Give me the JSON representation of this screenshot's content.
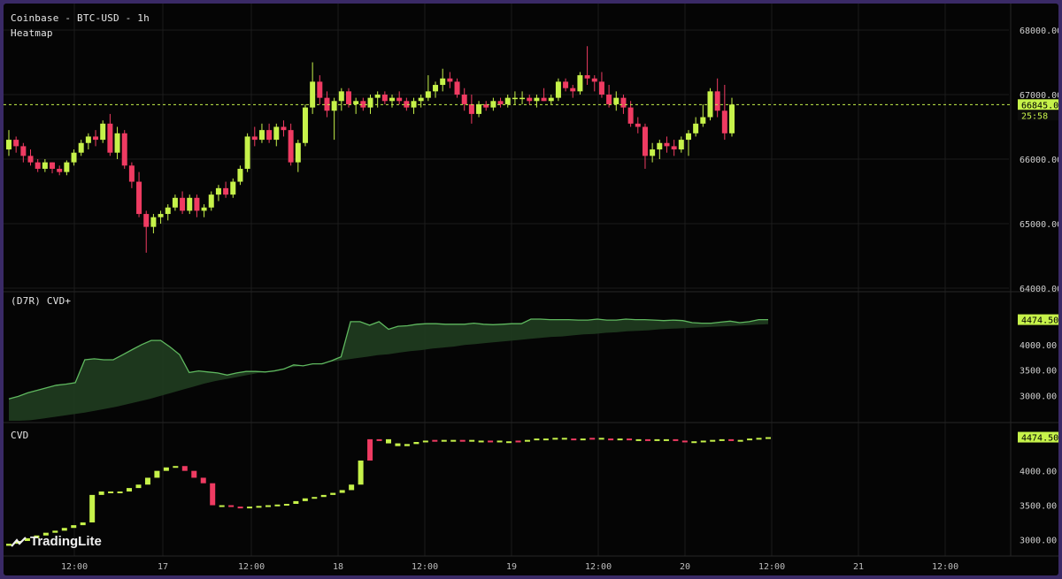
{
  "header": {
    "title": "Coinbase - BTC-USD - 1h",
    "overlay": "Heatmap"
  },
  "panes": {
    "cvd_plus_title": "(D7R) CVD+",
    "cvd_title": "CVD"
  },
  "brand": {
    "name": "TradingLite"
  },
  "colors": {
    "up": "#c6f24a",
    "down": "#ef3b62",
    "grid": "#1c1c1c",
    "axis_text": "#d0d0d0",
    "last_price_line": "#c6f24a",
    "cvd_fill": "#1f3a1f",
    "cvd_line": "#5fb85f",
    "background": "#050505"
  },
  "chart_data": [
    {
      "type": "candlestick",
      "title": "Coinbase - BTC-USD - 1h",
      "ylim": [
        64000,
        68000
      ],
      "y_ticks": [
        "68000.00",
        "67000.00",
        "66000.00",
        "65000.00",
        "64000.00"
      ],
      "last_price_label": "66845.02",
      "countdown_label": "25:58",
      "last_price": 66845.02,
      "x_ticks": [
        "12:00",
        "17",
        "12:00",
        "18",
        "12:00",
        "19",
        "12:00",
        "20",
        "12:00",
        "21",
        "12:00"
      ],
      "candles": [
        [
          66150,
          66450,
          66050,
          66300
        ],
        [
          66300,
          66350,
          66100,
          66200
        ],
        [
          66200,
          66250,
          65950,
          66050
        ],
        [
          66050,
          66150,
          65900,
          65950
        ],
        [
          65950,
          66000,
          65800,
          65850
        ],
        [
          65850,
          66000,
          65800,
          65950
        ],
        [
          65950,
          65950,
          65780,
          65850
        ],
        [
          65850,
          65900,
          65750,
          65800
        ],
        [
          65800,
          65980,
          65750,
          65950
        ],
        [
          65950,
          66150,
          65900,
          66100
        ],
        [
          66100,
          66300,
          66050,
          66250
        ],
        [
          66250,
          66400,
          66150,
          66350
        ],
        [
          66350,
          66450,
          66200,
          66300
        ],
        [
          66300,
          66600,
          66250,
          66550
        ],
        [
          66550,
          66700,
          66050,
          66100
        ],
        [
          66100,
          66500,
          66000,
          66400
        ],
        [
          66400,
          66450,
          65850,
          65900
        ],
        [
          65900,
          65950,
          65550,
          65650
        ],
        [
          65650,
          65800,
          65100,
          65150
        ],
        [
          65150,
          65200,
          64550,
          64950
        ],
        [
          64950,
          65150,
          64850,
          65100
        ],
        [
          65100,
          65200,
          65000,
          65150
        ],
        [
          65150,
          65300,
          65050,
          65250
        ],
        [
          65250,
          65450,
          65200,
          65400
        ],
        [
          65400,
          65500,
          65150,
          65200
        ],
        [
          65200,
          65450,
          65150,
          65400
        ],
        [
          65400,
          65450,
          65100,
          65200
        ],
        [
          65200,
          65300,
          65100,
          65250
        ],
        [
          65250,
          65500,
          65200,
          65450
        ],
        [
          65450,
          65600,
          65350,
          65550
        ],
        [
          65550,
          65650,
          65400,
          65450
        ],
        [
          65450,
          65700,
          65400,
          65650
        ],
        [
          65650,
          65900,
          65600,
          65850
        ],
        [
          65850,
          66400,
          65800,
          66350
        ],
        [
          66350,
          66500,
          66200,
          66300
        ],
        [
          66300,
          66550,
          66250,
          66450
        ],
        [
          66450,
          66550,
          66250,
          66300
        ],
        [
          66300,
          66550,
          66200,
          66500
        ],
        [
          66500,
          66600,
          66350,
          66450
        ],
        [
          66450,
          66550,
          65900,
          65950
        ],
        [
          65950,
          66300,
          65800,
          66250
        ],
        [
          66250,
          66850,
          66200,
          66800
        ],
        [
          66800,
          67500,
          66700,
          67200
        ],
        [
          67200,
          67300,
          66850,
          66950
        ],
        [
          66950,
          67050,
          66650,
          66750
        ],
        [
          66750,
          66950,
          66300,
          66900
        ],
        [
          66900,
          67100,
          66750,
          67050
        ],
        [
          67050,
          67100,
          66800,
          66850
        ],
        [
          66850,
          66950,
          66700,
          66900
        ],
        [
          66900,
          66950,
          66750,
          66800
        ],
        [
          66800,
          67000,
          66700,
          66950
        ],
        [
          66950,
          67050,
          66800,
          67000
        ],
        [
          67000,
          67050,
          66850,
          66900
        ],
        [
          66900,
          67000,
          66800,
          66950
        ],
        [
          66950,
          67050,
          66850,
          66900
        ],
        [
          66900,
          66950,
          66750,
          66800
        ],
        [
          66800,
          66950,
          66700,
          66900
        ],
        [
          66900,
          67000,
          66800,
          66950
        ],
        [
          66950,
          67300,
          66900,
          67050
        ],
        [
          67050,
          67200,
          66950,
          67150
        ],
        [
          67150,
          67400,
          67050,
          67250
        ],
        [
          67250,
          67350,
          67100,
          67200
        ],
        [
          67200,
          67250,
          66950,
          67000
        ],
        [
          67000,
          67100,
          66750,
          66850
        ],
        [
          66850,
          67000,
          66550,
          66700
        ],
        [
          66700,
          66900,
          66650,
          66850
        ],
        [
          66850,
          66900,
          66750,
          66800
        ],
        [
          66800,
          66950,
          66750,
          66900
        ],
        [
          66900,
          66950,
          66800,
          66850
        ],
        [
          66850,
          67000,
          66800,
          66950
        ],
        [
          66950,
          67050,
          66850,
          66950
        ],
        [
          66950,
          67050,
          66850,
          66950
        ],
        [
          66950,
          67000,
          66850,
          66900
        ],
        [
          66900,
          67000,
          66800,
          66950
        ],
        [
          66950,
          67100,
          66900,
          66900
        ],
        [
          66900,
          67000,
          66850,
          66950
        ],
        [
          66950,
          67250,
          66900,
          67200
        ],
        [
          67200,
          67250,
          67050,
          67100
        ],
        [
          67100,
          67150,
          66950,
          67050
        ],
        [
          67050,
          67350,
          67000,
          67300
        ],
        [
          67300,
          67750,
          67150,
          67250
        ],
        [
          67250,
          67300,
          67050,
          67200
        ],
        [
          67200,
          67350,
          66950,
          67000
        ],
        [
          67000,
          67150,
          66800,
          66850
        ],
        [
          66850,
          67050,
          66750,
          66950
        ],
        [
          66950,
          67000,
          66700,
          66800
        ],
        [
          66800,
          66900,
          66500,
          66550
        ],
        [
          66550,
          66650,
          66400,
          66500
        ],
        [
          66500,
          66550,
          65850,
          66050
        ],
        [
          66050,
          66250,
          65950,
          66150
        ],
        [
          66150,
          66300,
          66000,
          66250
        ],
        [
          66250,
          66350,
          66100,
          66200
        ],
        [
          66200,
          66300,
          66050,
          66150
        ],
        [
          66150,
          66350,
          66100,
          66300
        ],
        [
          66300,
          66450,
          66050,
          66400
        ],
        [
          66400,
          66650,
          66350,
          66550
        ],
        [
          66550,
          66850,
          66500,
          66650
        ],
        [
          66650,
          67100,
          66600,
          67050
        ],
        [
          67050,
          67250,
          66650,
          66750
        ],
        [
          66750,
          67150,
          66300,
          66400
        ],
        [
          66400,
          66950,
          66350,
          66845
        ]
      ]
    },
    {
      "type": "area",
      "title": "(D7R) CVD+",
      "ylim": [
        2500,
        4900
      ],
      "y_ticks": [
        "4000.00",
        "3500.00",
        "3000.00"
      ],
      "last_value_label": "4474.506",
      "values": [
        2930,
        2980,
        3050,
        3100,
        3150,
        3200,
        3220,
        3250,
        3700,
        3720,
        3700,
        3700,
        3800,
        3900,
        4000,
        4080,
        4080,
        3950,
        3800,
        3450,
        3480,
        3460,
        3440,
        3400,
        3440,
        3470,
        3470,
        3460,
        3480,
        3520,
        3600,
        3580,
        3620,
        3620,
        3680,
        3760,
        4450,
        4450,
        4380,
        4450,
        4300,
        4360,
        4370,
        4400,
        4410,
        4410,
        4400,
        4400,
        4400,
        4420,
        4400,
        4390,
        4400,
        4410,
        4410,
        4500,
        4500,
        4490,
        4490,
        4490,
        4480,
        4480,
        4500,
        4480,
        4480,
        4500,
        4490,
        4490,
        4480,
        4470,
        4480,
        4470,
        4430,
        4420,
        4420,
        4440,
        4460,
        4430,
        4450,
        4490,
        4490
      ],
      "baseline": [
        2450,
        2480,
        2510,
        2540,
        2570,
        2600,
        2630,
        2660,
        2700,
        2740,
        2780,
        2830,
        2880,
        2930,
        2990,
        3050,
        3110,
        3170,
        3230,
        3280,
        3320,
        3360,
        3400,
        3440,
        3480,
        3520,
        3550,
        3580,
        3610,
        3640,
        3670,
        3700,
        3730,
        3760,
        3790,
        3810,
        3840,
        3870,
        3890,
        3920,
        3940,
        3960,
        3990,
        4010,
        4030,
        4050,
        4070,
        4090,
        4110,
        4130,
        4150,
        4160,
        4180,
        4200,
        4210,
        4230,
        4240,
        4260,
        4270,
        4280,
        4300,
        4310,
        4320,
        4330,
        4340,
        4350,
        4360,
        4370,
        4380,
        4390,
        4400
      ]
    },
    {
      "type": "bar",
      "title": "CVD",
      "ylim": [
        2800,
        4600
      ],
      "y_ticks": [
        "4000.00",
        "3500.00",
        "3000.00"
      ],
      "last_value_label": "4474.506",
      "values": [
        2940,
        2980,
        3020,
        3060,
        3100,
        3130,
        3170,
        3210,
        3250,
        3650,
        3700,
        3700,
        3700,
        3750,
        3800,
        3900,
        4000,
        4050,
        4070,
        4000,
        3900,
        3820,
        3500,
        3500,
        3480,
        3470,
        3480,
        3490,
        3500,
        3510,
        3520,
        3560,
        3600,
        3620,
        3650,
        3680,
        3720,
        3800,
        4150,
        4460,
        4460,
        4400,
        4360,
        4390,
        4420,
        4440,
        4450,
        4450,
        4450,
        4450,
        4440,
        4440,
        4440,
        4430,
        4430,
        4440,
        4450,
        4470,
        4470,
        4480,
        4470,
        4470,
        4470,
        4480,
        4470,
        4470,
        4470,
        4460,
        4460,
        4460,
        4450,
        4460,
        4440,
        4420,
        4430,
        4440,
        4450,
        4460,
        4440,
        4450,
        4470,
        4480,
        4490
      ],
      "colors_seq": "gggggggggggggggggggrrrrgrrgggggggggggggrrgggggrggrggrggrgggggrgrgrgrgrggrrggggrggggggg"
    }
  ]
}
